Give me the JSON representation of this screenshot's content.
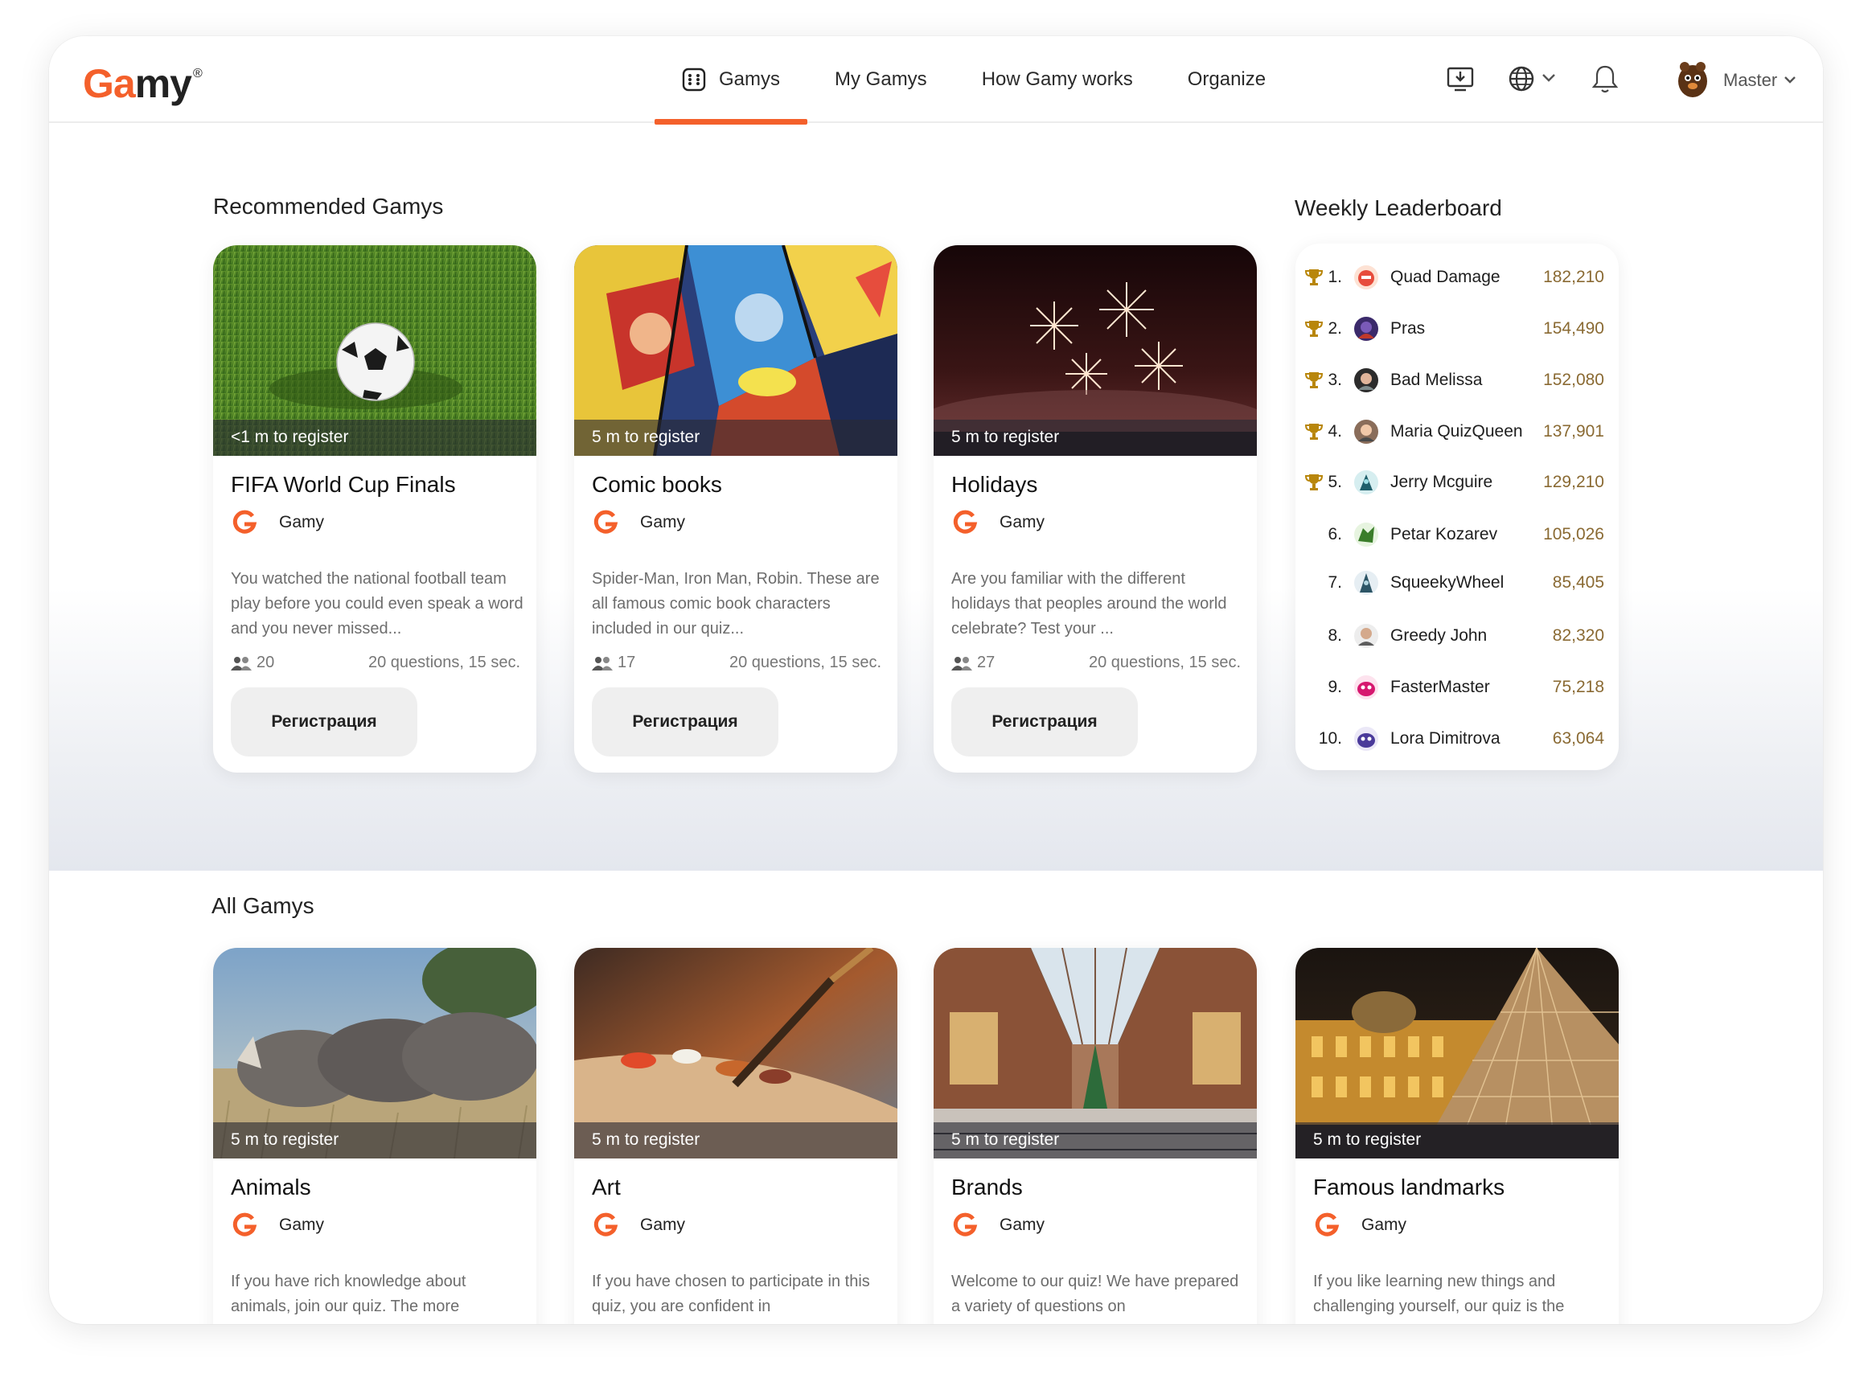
{
  "brand": {
    "logo_ga": "Ga",
    "logo_my": "my",
    "logo_mark": "®"
  },
  "nav": {
    "items": [
      {
        "label": "Gamys",
        "active": true
      },
      {
        "label": "My Gamys",
        "active": false
      },
      {
        "label": "How Gamy works",
        "active": false
      },
      {
        "label": "Organize",
        "active": false
      }
    ]
  },
  "header": {
    "user_name": "Master",
    "icons": [
      "install-icon",
      "globe-icon",
      "chevron-down-icon",
      "bell-icon",
      "avatar"
    ]
  },
  "colors": {
    "accent": "#f4602b",
    "score": "#8a6a33",
    "trophy": "#b8860b"
  },
  "recommended": {
    "title": "Recommended Gamys",
    "cards": [
      {
        "register": "<1 m to register",
        "title": "FIFA World Cup Finals",
        "brand": "Gamy",
        "desc": "You watched the national football team play before you could even speak a word and you never missed...",
        "players": "20",
        "questions": "20 questions, 15 sec.",
        "button": "Регистрация",
        "image": "soccer-ball-on-grass"
      },
      {
        "register": "5 m to register",
        "title": "Comic books",
        "brand": "Gamy",
        "desc": "Spider-Man, Iron Man, Robin. These are all famous comic book characters included in our quiz...",
        "players": "17",
        "questions": "20 questions, 15 sec.",
        "button": "Регистрация",
        "image": "comic-book-pages"
      },
      {
        "register": "5 m to register",
        "title": "Holidays",
        "brand": "Gamy",
        "desc": "Are you familiar with the different holidays that peoples around the world celebrate? Test your ...",
        "players": "27",
        "questions": "20 questions, 15 sec.",
        "button": "Регистрация",
        "image": "fireworks"
      }
    ]
  },
  "leaderboard": {
    "title": "Weekly Leaderboard",
    "rows": [
      {
        "rank": "1.",
        "name": "Quad Damage",
        "score": "182,210",
        "trophy": true
      },
      {
        "rank": "2.",
        "name": "Pras",
        "score": "154,490",
        "trophy": true
      },
      {
        "rank": "3.",
        "name": "Bad Melissa",
        "score": "152,080",
        "trophy": true
      },
      {
        "rank": "4.",
        "name": "Maria QuizQueen",
        "score": "137,901",
        "trophy": true
      },
      {
        "rank": "5.",
        "name": "Jerry Mcguire",
        "score": "129,210",
        "trophy": true
      },
      {
        "rank": "6.",
        "name": "Petar Kozarev",
        "score": "105,026",
        "trophy": false
      },
      {
        "rank": "7.",
        "name": "SqueekyWheel",
        "score": "85,405",
        "trophy": false
      },
      {
        "rank": "8.",
        "name": "Greedy John",
        "score": "82,320",
        "trophy": false
      },
      {
        "rank": "9.",
        "name": "FasterMaster",
        "score": "75,218",
        "trophy": false
      },
      {
        "rank": "10.",
        "name": "Lora Dimitrova",
        "score": "63,064",
        "trophy": false
      }
    ]
  },
  "all": {
    "title": "All Gamys",
    "cards": [
      {
        "register": "5 m to register",
        "title": "Animals",
        "brand": "Gamy",
        "desc": "If you have rich knowledge about animals, join our quiz. The more",
        "image": "rhinos"
      },
      {
        "register": "5 m to register",
        "title": "Art",
        "brand": "Gamy",
        "desc": "If you have chosen to participate in this quiz, you are confident in",
        "image": "paint-brush-palette"
      },
      {
        "register": "5 m to register",
        "title": "Brands",
        "brand": "Gamy",
        "desc": "Welcome to our quiz! We have prepared a variety of questions on",
        "image": "shopping-arcade"
      },
      {
        "register": "5 m to register",
        "title": "Famous landmarks",
        "brand": "Gamy",
        "desc": "If you like learning new things and challenging yourself, our quiz is the",
        "image": "louvre-pyramid"
      }
    ]
  }
}
